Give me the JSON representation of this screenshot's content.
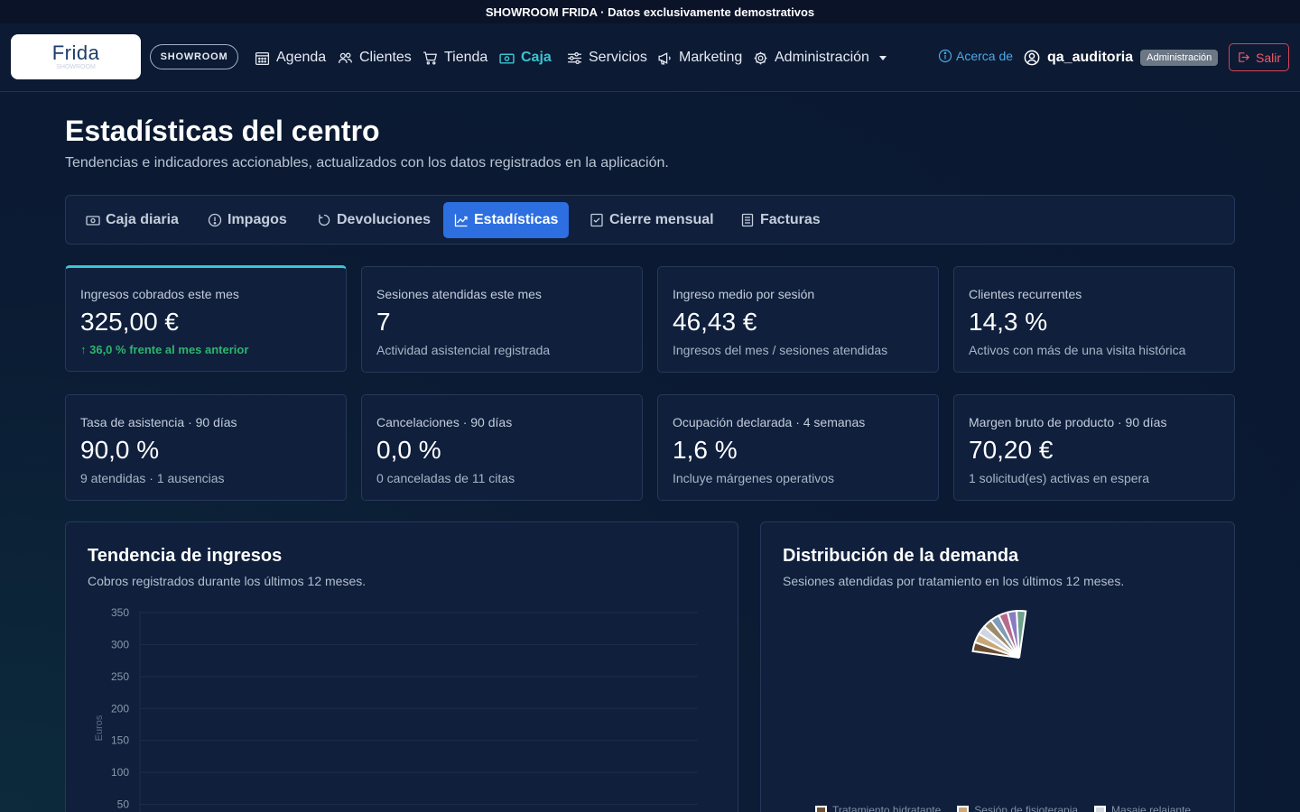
{
  "banner": {
    "text": "SHOWROOM FRIDA · Datos exclusivamente demostrativos"
  },
  "navbar": {
    "logo_text": "Frida",
    "logo_subtext": "SHOWROOM",
    "showroom_label": "SHOWROOM",
    "items": [
      {
        "label": "Agenda",
        "icon": "calendar-icon"
      },
      {
        "label": "Clientes",
        "icon": "users-icon"
      },
      {
        "label": "Tienda",
        "icon": "cart-icon"
      },
      {
        "label": "Caja",
        "icon": "cash-icon",
        "active": true
      },
      {
        "label": "Servicios",
        "icon": "sliders-icon"
      },
      {
        "label": "Marketing",
        "icon": "megaphone-icon"
      },
      {
        "label": "Administración",
        "icon": "gear-icon"
      }
    ],
    "about_label": "Acerca de",
    "username": "qa_auditoria",
    "role_badge": "Administración",
    "logout_label": "Salir"
  },
  "page": {
    "title": "Estadísticas del centro",
    "subtitle": "Tendencias e indicadores accionables, actualizados con los datos registrados en la aplicación."
  },
  "tabs": [
    {
      "label": "Caja diaria",
      "icon": "cash-icon"
    },
    {
      "label": "Impagos",
      "icon": "alert-circle-icon"
    },
    {
      "label": "Devoluciones",
      "icon": "rotate-icon"
    },
    {
      "label": "Estadísticas",
      "icon": "chart-line-icon",
      "active": true
    },
    {
      "label": "Cierre mensual",
      "icon": "checklist-icon"
    },
    {
      "label": "Facturas",
      "icon": "document-icon"
    }
  ],
  "kpis": [
    {
      "label": "Ingresos cobrados este mes",
      "value": "325,00 €",
      "note": "↑ 36,0 % frente al mes anterior",
      "positive": true
    },
    {
      "label": "Sesiones atendidas este mes",
      "value": "7",
      "note": "Actividad asistencial registrada"
    },
    {
      "label": "Ingreso medio por sesión",
      "value": "46,43 €",
      "note": "Ingresos del mes / sesiones atendidas"
    },
    {
      "label": "Clientes recurrentes",
      "value": "14,3 %",
      "note": "Activos con más de una visita histórica"
    },
    {
      "label": "Tasa de asistencia · 90 días",
      "value": "90,0 %",
      "note": "9 atendidas · 1 ausencias"
    },
    {
      "label": "Cancelaciones · 90 días",
      "value": "0,0 %",
      "note": "0 canceladas de 11 citas"
    },
    {
      "label": "Ocupación declarada · 4 semanas",
      "value": "1,6 %",
      "note": "Incluye márgenes operativos"
    },
    {
      "label": "Margen bruto de producto · 90 días",
      "value": "70,20 €",
      "note": "1 solicitud(es) activas en espera"
    }
  ],
  "revenue_panel": {
    "title": "Tendencia de ingresos",
    "subtitle": "Cobros registrados durante los últimos 12 meses."
  },
  "demand_panel": {
    "title": "Distribución de la demanda",
    "subtitle": "Sesiones atendidas por tratamiento en los últimos 12 meses."
  },
  "chart_data": [
    {
      "type": "line",
      "ylabel": "Euros",
      "ylim": [
        0,
        350
      ],
      "y_ticks": [
        350,
        300,
        250,
        200,
        150,
        100,
        50
      ],
      "grid": true,
      "series": []
    },
    {
      "type": "pie",
      "legend_position": "bottom",
      "slices": [
        {
          "name": "Tratamiento hidratante",
          "color": "#6b4e32"
        },
        {
          "name": "Sesión de fisioterapia",
          "color": "#c8a779"
        },
        {
          "name": "Masaje relajante",
          "color": "#cfd6df"
        },
        {
          "color": "#9b8b6a"
        },
        {
          "color": "#7e9bb8"
        },
        {
          "color": "#b86a8c"
        },
        {
          "color": "#8a7bc4"
        },
        {
          "color": "#6fa08d"
        }
      ]
    }
  ],
  "colors": {
    "accent": "#39c3d2",
    "primary": "#2d6fe0",
    "danger": "#ef5a68",
    "positive": "#2db56c"
  }
}
